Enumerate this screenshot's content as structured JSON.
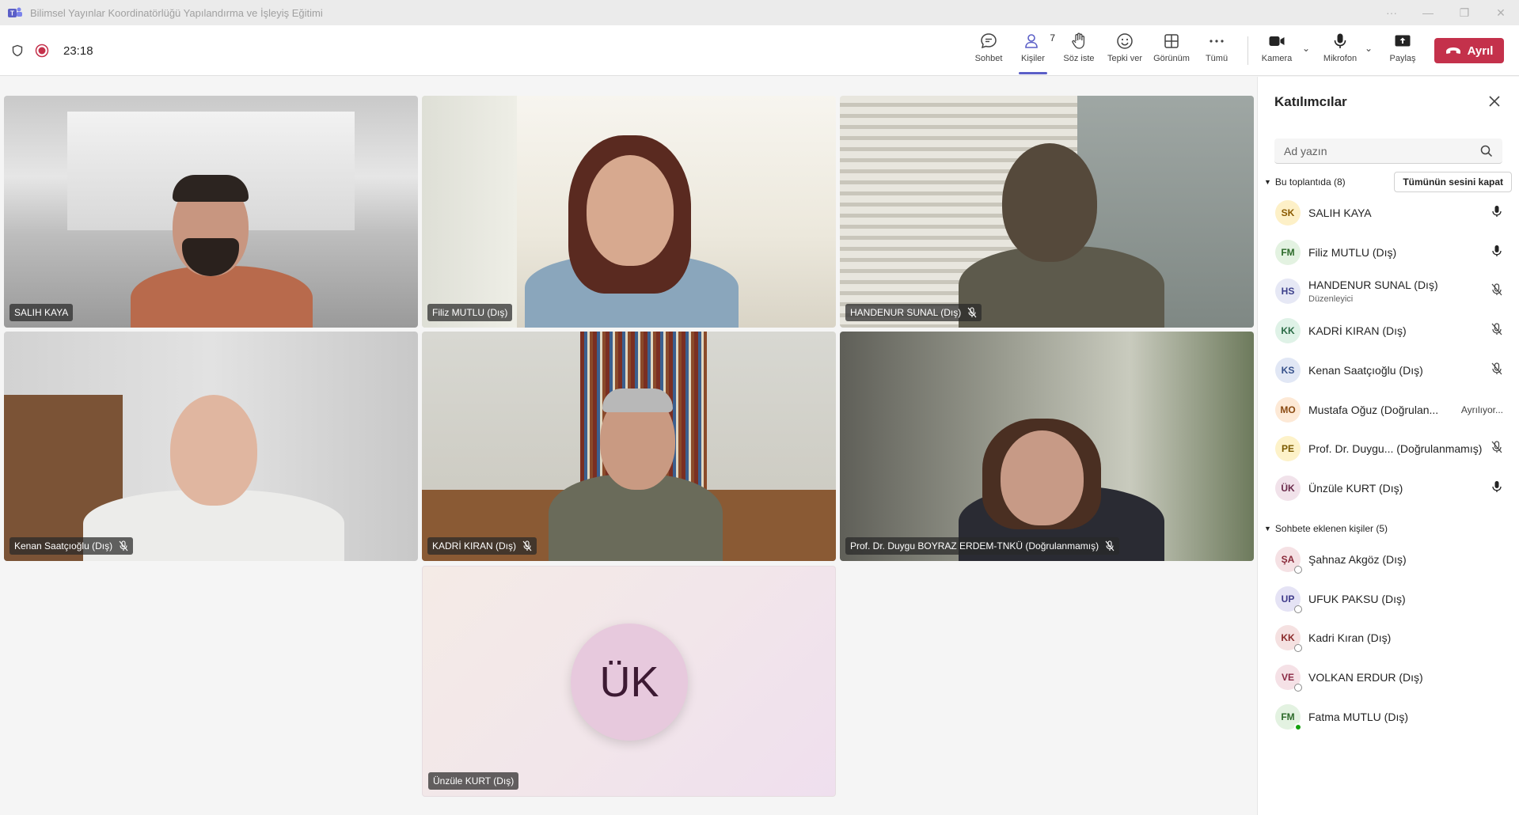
{
  "window": {
    "title": "Bilimsel Yayınlar Koordinatörlüğü Yapılandırma ve İşleyiş Eğitimi"
  },
  "toolbar": {
    "timer": "23:18",
    "buttons": {
      "chat": "Sohbet",
      "people": "Kişiler",
      "people_count": "7",
      "raise_hand": "Söz iste",
      "react": "Tepki ver",
      "view": "Görünüm",
      "more": "Tümü",
      "camera": "Kamera",
      "mic": "Mikrofon",
      "share": "Paylaş"
    },
    "leave_label": "Ayrıl",
    "leave_color": "#c4314b",
    "accent_color": "#5b5fc7"
  },
  "tiles": [
    {
      "name": "SALIH KAYA",
      "muted": false
    },
    {
      "name": "Filiz MUTLU (Dış)",
      "muted": false
    },
    {
      "name": "HANDENUR SUNAL (Dış)",
      "muted": true
    },
    {
      "name": "Kenan Saatçıoğlu (Dış)",
      "muted": true
    },
    {
      "name": "KADRİ KIRAN (Dış)",
      "muted": true
    },
    {
      "name": "Prof. Dr. Duygu BOYRAZ ERDEM-TNKÜ (Doğrulanmamış)",
      "muted": true
    },
    {
      "name": "Ünzüle KURT (Dış)",
      "muted": false,
      "initials": "ÜK"
    }
  ],
  "panel": {
    "title": "Katılımcılar",
    "search_placeholder": "Ad yazın",
    "in_meeting_label": "Bu toplantıda (8)",
    "mute_all_label": "Tümünün sesini kapat",
    "in_meeting": [
      {
        "initials": "SK",
        "name": "SALIH KAYA",
        "mic": "on"
      },
      {
        "initials": "FM",
        "name": "Filiz MUTLU (Dış)",
        "mic": "on"
      },
      {
        "initials": "HS",
        "name": "HANDENUR SUNAL (Dış)",
        "role": "Düzenleyici",
        "mic": "off"
      },
      {
        "initials": "KK",
        "name": "KADRİ KIRAN (Dış)",
        "mic": "off"
      },
      {
        "initials": "KS",
        "name": "Kenan Saatçıoğlu (Dış)",
        "mic": "off"
      },
      {
        "initials": "MO",
        "name": "Mustafa Oğuz (Doğrulan...",
        "status": "Ayrılıyor..."
      },
      {
        "initials": "PE",
        "name": "Prof. Dr. Duygu... (Doğrulanmamış)",
        "mic": "off"
      },
      {
        "initials": "ÜK",
        "name": "Ünzüle KURT (Dış)",
        "mic": "on"
      }
    ],
    "chat_added_label": "Sohbete eklenen kişiler (5)",
    "chat_added": [
      {
        "initials": "ŞA",
        "name": "Şahnaz Akgöz (Dış)"
      },
      {
        "initials": "UP",
        "name": "UFUK PAKSU (Dış)"
      },
      {
        "initials": "KK",
        "name": "Kadri Kıran (Dış)"
      },
      {
        "initials": "VE",
        "name": "VOLKAN ERDUR (Dış)"
      },
      {
        "initials": "FM",
        "name": "Fatma MUTLU (Dış)"
      }
    ]
  }
}
